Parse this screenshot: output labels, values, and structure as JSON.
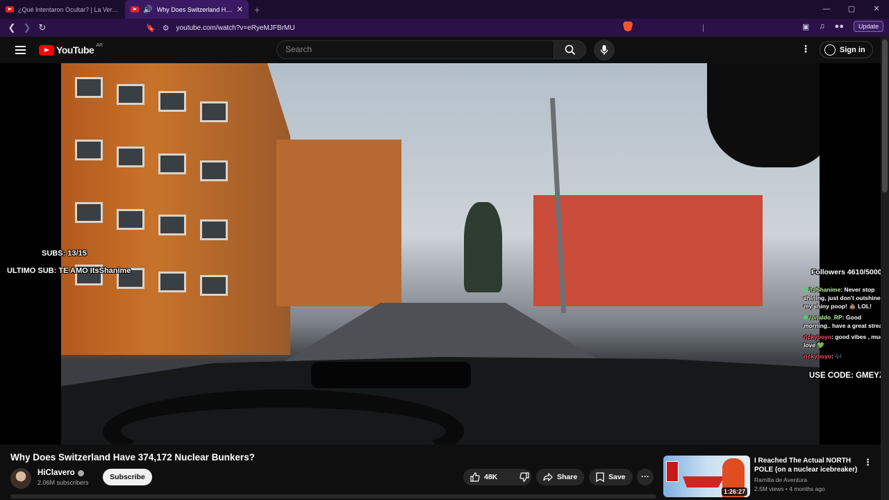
{
  "browser": {
    "tabs": [
      {
        "title": "¿Qué Intentaron Ocultar? | La Verdad",
        "active": false
      },
      {
        "title": "Why Does Switzerland Have",
        "active": true
      }
    ],
    "url": "youtube.com/watch?v=eRyeMJFBrMU",
    "update_label": "Update"
  },
  "header": {
    "logo_text": "YouTube",
    "country_code": "AR",
    "search_placeholder": "Search",
    "signin_label": "Sign in"
  },
  "stream_overlay": {
    "subs_goal": "SUBS: 13/15",
    "last_sub": "ULTIMO SUB: TE AMO ItsShanime",
    "followers": "Followers 4610/5000",
    "promo_code": "USE CODE: GMEYZ",
    "chat": [
      {
        "user": "ItsShanime",
        "message": ": Never stop shining, just don't outshine my shiny poop! 💩 LOL!",
        "color": "#b8f0a0"
      },
      {
        "user": "ronaldo_RP",
        "message": ": Good morning.. have a great stream",
        "color": "#b8f0a0"
      },
      {
        "user": "rickyboyo",
        "message": ": good vibes , much love 💚",
        "color": "#ff4a6a"
      },
      {
        "user": "rickyboyo",
        "message": ": 🎶",
        "color": "#ff4a6a"
      }
    ]
  },
  "video": {
    "title": "Why Does Switzerland Have 374,172 Nuclear Bunkers?",
    "channel": "HiClavero",
    "subscribers": "2.06M subscribers",
    "subscribe_label": "Subscribe",
    "likes": "48K",
    "share_label": "Share",
    "save_label": "Save"
  },
  "recommendation": {
    "title": "I Reached The Actual NORTH POLE (on a nuclear icebreaker)",
    "channel": "Ramilla de Aventura",
    "meta": "2.5M views • 4 months ago",
    "duration": "1:26:27"
  },
  "colors": {
    "brand": "#ff0000",
    "browser_frame": "#2a1148",
    "background": "#0f0f0f"
  }
}
